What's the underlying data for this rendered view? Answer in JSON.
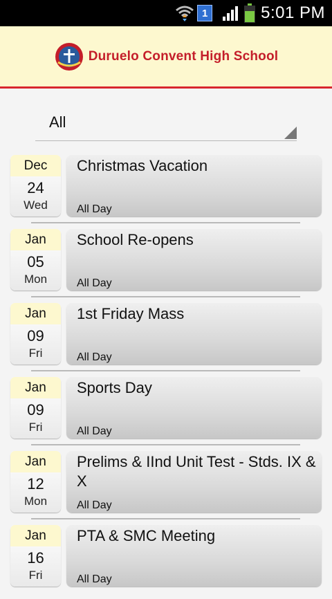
{
  "status_bar": {
    "time": "5:01 PM",
    "notification_count": "1",
    "icons": [
      "wifi-icon",
      "notification-badge",
      "signal-icon",
      "battery-icon"
    ]
  },
  "header": {
    "school_name": "Duruelo Convent High School",
    "logo": "school-crest-logo"
  },
  "filter": {
    "selected": "All"
  },
  "colors": {
    "header_bg": "#fdf8cf",
    "header_border": "#d8262e",
    "brand_red": "#c41e2a"
  },
  "events": [
    {
      "month": "Dec",
      "day": "24",
      "weekday": "Wed",
      "title": "Christmas Vacation",
      "time": "All Day"
    },
    {
      "month": "Jan",
      "day": "05",
      "weekday": "Mon",
      "title": "School Re-opens",
      "time": "All Day"
    },
    {
      "month": "Jan",
      "day": "09",
      "weekday": "Fri",
      "title": "1st Friday Mass",
      "time": "All Day"
    },
    {
      "month": "Jan",
      "day": "09",
      "weekday": "Fri",
      "title": "Sports Day",
      "time": "All Day"
    },
    {
      "month": "Jan",
      "day": "12",
      "weekday": "Mon",
      "title": "Prelims & IInd Unit Test - Stds. IX & X",
      "time": "All Day"
    },
    {
      "month": "Jan",
      "day": "16",
      "weekday": "Fri",
      "title": "PTA & SMC Meeting",
      "time": "All Day"
    }
  ]
}
